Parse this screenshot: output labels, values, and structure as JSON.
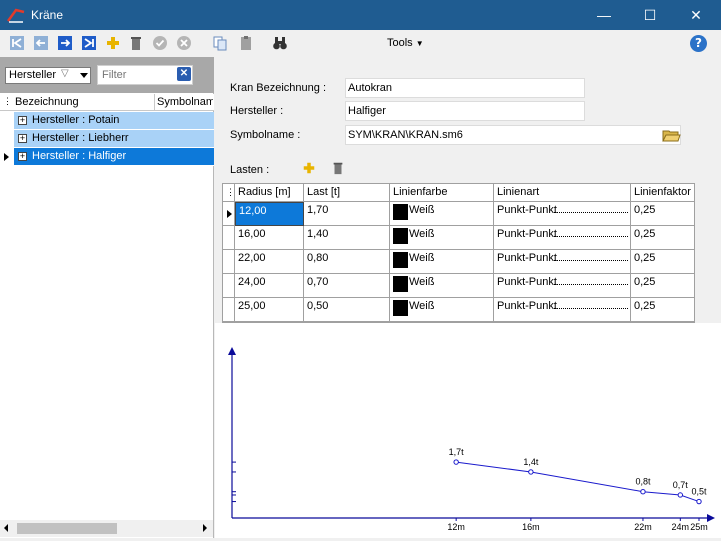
{
  "window": {
    "title": "Kräne",
    "minimize": "—",
    "maximize": "☐",
    "close": "✕"
  },
  "toolbar": {
    "icons": [
      "first-record-icon",
      "previous-record-icon",
      "next-record-icon",
      "last-record-icon",
      "add-icon",
      "delete-icon",
      "confirm-icon",
      "cancel-icon",
      "copy-icon",
      "paste-icon",
      "binoculars-icon"
    ],
    "tools_label": "Tools",
    "help": "?"
  },
  "filter": {
    "field": "Hersteller",
    "placeholder": "Filter"
  },
  "tree": {
    "columns": [
      "Bezeichnung",
      "Symbolname"
    ],
    "rows": [
      {
        "label": "Hersteller : Potain"
      },
      {
        "label": "Hersteller : Liebherr"
      },
      {
        "label": "Hersteller : Halfiger"
      }
    ]
  },
  "form": {
    "kran_label": "Kran Bezeichnung :",
    "kran_value": "Autokran",
    "hersteller_label": "Hersteller :",
    "hersteller_value": "Halfiger",
    "symbol_label": "Symbolname :",
    "symbol_value": "SYM\\KRAN\\KRAN.sm6",
    "lasten_label": "Lasten :"
  },
  "grid": {
    "columns": [
      "Radius [m]",
      "Last [t]",
      "Linienfarbe",
      "Linienart",
      "Linienfaktor"
    ],
    "rows": [
      {
        "radius": "12,00",
        "last": "1,70",
        "farbe": "Weiß",
        "art": "Punkt-Punkt",
        "faktor": "0,25"
      },
      {
        "radius": "16,00",
        "last": "1,40",
        "farbe": "Weiß",
        "art": "Punkt-Punkt",
        "faktor": "0,25"
      },
      {
        "radius": "22,00",
        "last": "0,80",
        "farbe": "Weiß",
        "art": "Punkt-Punkt",
        "faktor": "0,25"
      },
      {
        "radius": "24,00",
        "last": "0,70",
        "farbe": "Weiß",
        "art": "Punkt-Punkt",
        "faktor": "0,25"
      },
      {
        "radius": "25,00",
        "last": "0,50",
        "farbe": "Weiß",
        "art": "Punkt-Punkt",
        "faktor": "0,25"
      }
    ]
  },
  "chart_data": {
    "type": "line",
    "x": [
      12,
      16,
      22,
      24,
      25
    ],
    "values": [
      1.7,
      1.4,
      0.8,
      0.7,
      0.5
    ],
    "point_labels": [
      "1,7t",
      "1,4t",
      "0,8t",
      "0,7t",
      "0,5t"
    ],
    "tick_labels": [
      "12m",
      "16m",
      "22m",
      "24m",
      "25m"
    ],
    "xlim": [
      0,
      25
    ],
    "ylim": [
      0,
      5.2
    ],
    "line_color": "#1a1acc",
    "axis_color": "#0a0a9a"
  }
}
